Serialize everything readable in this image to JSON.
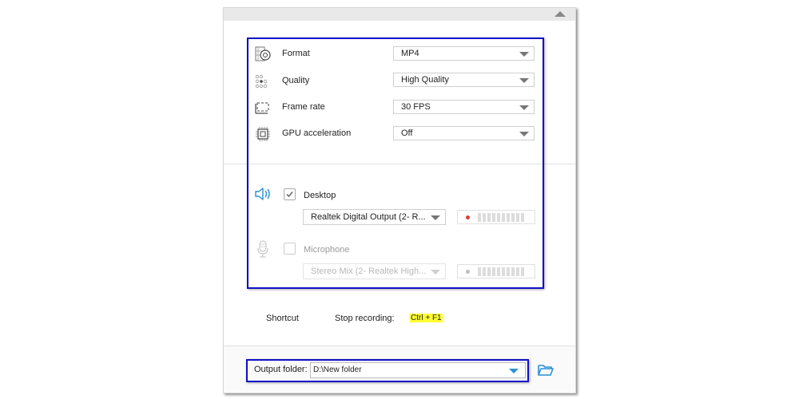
{
  "settings": {
    "format": {
      "label": "Format",
      "icon": "format-gear-icon",
      "value": "MP4"
    },
    "quality": {
      "label": "Quality",
      "icon": "quality-dots-icon",
      "value": "High Quality"
    },
    "frame_rate": {
      "label": "Frame rate",
      "icon": "frame-rate-icon",
      "value": "30 FPS"
    },
    "gpu": {
      "label": "GPU acceleration",
      "icon": "chip-icon",
      "value": "Off"
    }
  },
  "audio": {
    "desktop": {
      "label": "Desktop",
      "icon": "speaker-icon",
      "checked": true,
      "device": "Realtek Digital Output (2- R...",
      "level_indicator_color": "#e53935",
      "accent_color": "#2a8fd8"
    },
    "microphone": {
      "label": "Microphone",
      "icon": "microphone-icon",
      "checked": false,
      "device": "Stereo Mix (2- Realtek High...",
      "level_indicator_color": "#bdbdbd"
    }
  },
  "shortcut": {
    "label": "Shortcut",
    "action": "Stop recording:",
    "keys": "Ctrl + F1",
    "highlight_color": "#ffff33"
  },
  "output": {
    "label": "Output folder:",
    "path": "D:\\New folder",
    "folder_icon": "open-folder-icon"
  },
  "annotation": {
    "highlight_border_color": "#1010c8"
  }
}
